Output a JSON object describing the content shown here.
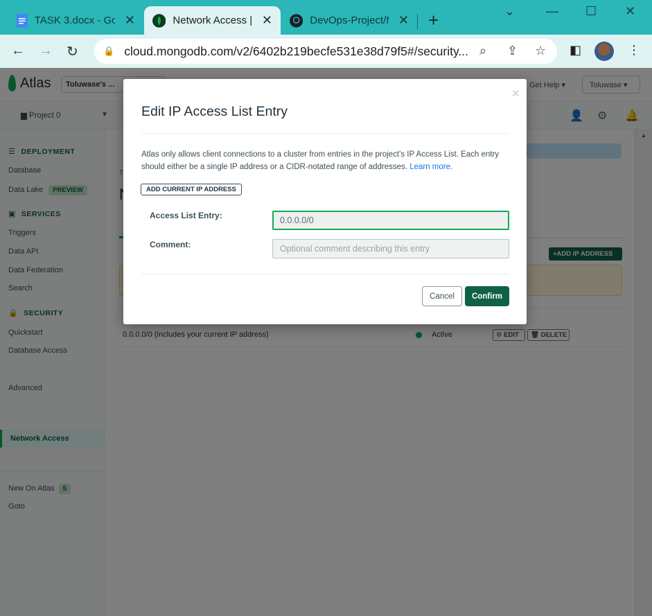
{
  "browser": {
    "tabs": [
      {
        "title": "TASK 3.docx - Goo",
        "icon": "google-docs-icon"
      },
      {
        "title": "Network Access | ",
        "icon": "mongodb-leaf-icon"
      },
      {
        "title": "DevOps-Project/M",
        "icon": "github-icon"
      }
    ],
    "url": "cloud.mongodb.com/v2/6402b219becfe531e38d79f5#/security..."
  },
  "app": {
    "brand": "Atlas",
    "org": "Toluwase's ...",
    "help": "Get Help",
    "user": "Toluwase",
    "project": "Project 0"
  },
  "sidebar": {
    "deployment": {
      "heading": "DEPLOYMENT",
      "items": [
        "Database",
        "Data Lake"
      ],
      "badge": "PREVIEW"
    },
    "services": {
      "heading": "SERVICES",
      "items": [
        "Triggers",
        "Data API",
        "Data Federation",
        "Search"
      ]
    },
    "security": {
      "heading": "SECURITY",
      "items": [
        "Quickstart",
        "Database Access",
        "Network Access",
        "Advanced"
      ]
    },
    "extra": {
      "new_on_atlas": "New On Atlas",
      "new_count": "5",
      "goto": "Goto"
    }
  },
  "main": {
    "add_ip_button": "+ADD IP ADDRESS",
    "entry": "0.0.0.0/0  (includes your current IP address)",
    "status": "Active",
    "edit": "EDIT",
    "delete": "DELETE"
  },
  "modal": {
    "title": "Edit IP Access List Entry",
    "description": "Atlas only allows client connections to a cluster from entries in the project’s IP Access List. Each entry should either be a single IP address or a CIDR-notated range of addresses.",
    "learn_more": "Learn more.",
    "add_current_ip": "ADD CURRENT IP ADDRESS",
    "access_label": "Access List Entry:",
    "access_value": "0.0.0.0/0",
    "comment_label": "Comment:",
    "comment_placeholder": "Optional comment describing this entry",
    "cancel": "Cancel",
    "confirm": "Confirm"
  },
  "colors": {
    "accent": "#116149",
    "brand_green": "#13aa52",
    "chrome_teal": "#2bb6b8"
  }
}
